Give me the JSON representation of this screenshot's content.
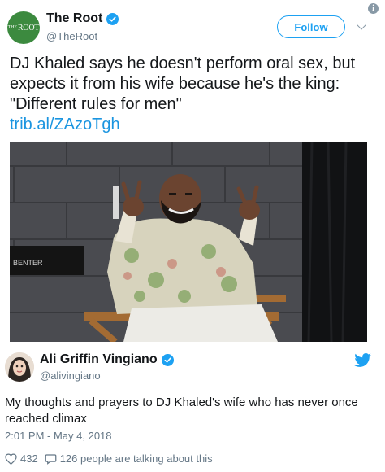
{
  "tweet1": {
    "avatar_text": "THE ROOT",
    "avatar_prefix": "THE",
    "avatar_word": "ROOT",
    "display_name": "The Root",
    "handle": "@TheRoot",
    "follow_label": "Follow",
    "text": "DJ Khaled says he doesn't perform oral sex, but expects it from his wife because he's the king: \"Different rules for men\"",
    "link": "trib.al/ZAzoTgh",
    "photo_chair_text": "BENTER"
  },
  "tweet2": {
    "display_name": "Ali Griffin Vingiano",
    "handle": "@alivingiano",
    "text": "My thoughts and prayers to DJ Khaled's wife who has never once reached climax",
    "timestamp": "2:01 PM - May 4, 2018",
    "likes": "432",
    "talking": "126 people are talking about this"
  },
  "colors": {
    "twitter_blue": "#1da1f2",
    "link_blue": "#1b95e0",
    "muted": "#657786",
    "root_green": "#3c8a3f"
  },
  "icons": [
    "info-icon",
    "verified-icon",
    "chevron-down-icon",
    "twitter-bird-icon",
    "heart-icon",
    "reply-icon"
  ]
}
